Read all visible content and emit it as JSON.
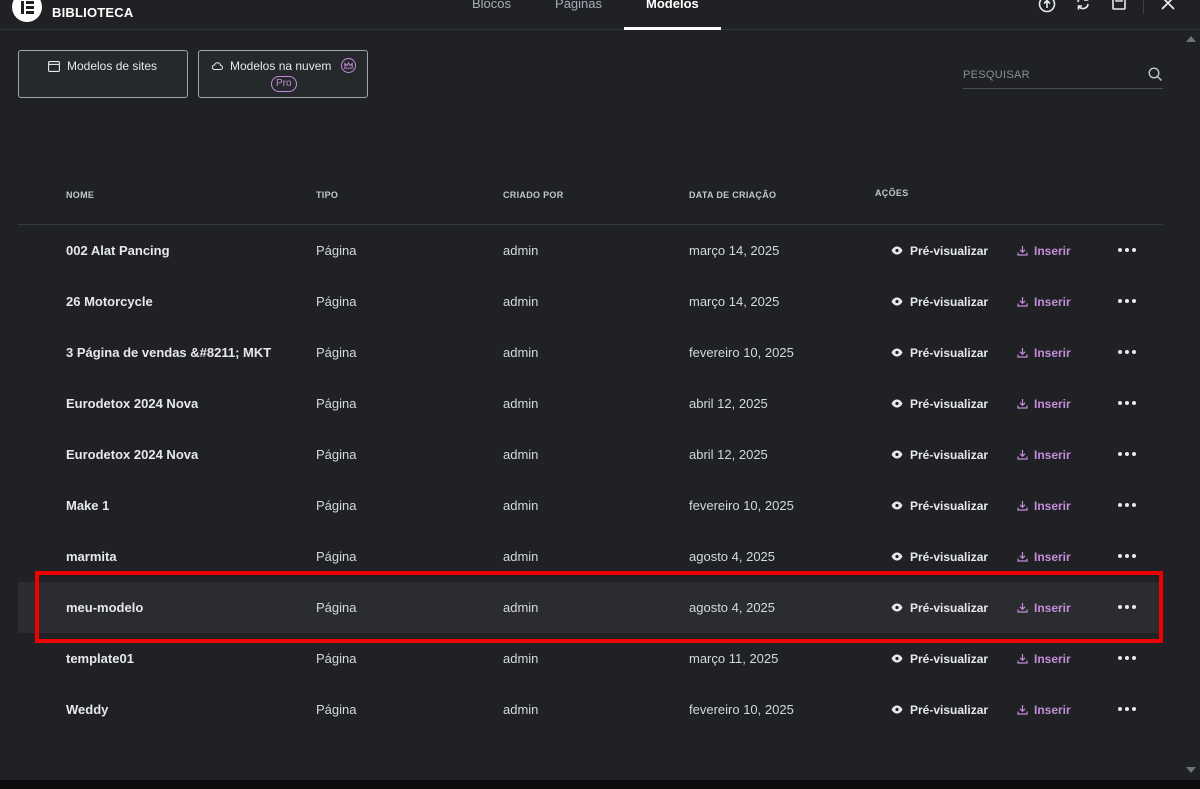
{
  "header": {
    "brand": "BIBLIOTECA",
    "tabs": [
      {
        "label": "Blocos",
        "active": false
      },
      {
        "label": "Páginas",
        "active": false
      },
      {
        "label": "Modelos",
        "active": true
      }
    ],
    "tools": [
      "upload-icon",
      "sync-icon",
      "save-icon",
      "close-icon"
    ]
  },
  "filters": {
    "site_templates": "Modelos de sites",
    "cloud_templates": "Modelos na nuvem",
    "pro_badge": "Pro"
  },
  "search": {
    "placeholder": "PESQUISAR"
  },
  "table": {
    "columns": {
      "name": "NOME",
      "type": "TIPO",
      "created_by": "CRIADO POR",
      "created_date": "DATA DE CRIAÇÃO",
      "actions": "AÇÕES"
    },
    "action_labels": {
      "preview": "Pré-visualizar",
      "insert": "Inserir"
    },
    "rows": [
      {
        "name": "002 Alat Pancing",
        "type": "Página",
        "author": "admin",
        "date": "março 14, 2025"
      },
      {
        "name": "26 Motorcycle",
        "type": "Página",
        "author": "admin",
        "date": "março 14, 2025"
      },
      {
        "name": "3 Página de vendas &#8211; MKT",
        "type": "Página",
        "author": "admin",
        "date": "fevereiro 10, 2025"
      },
      {
        "name": "Eurodetox 2024 Nova",
        "type": "Página",
        "author": "admin",
        "date": "abril 12, 2025"
      },
      {
        "name": "Eurodetox 2024 Nova",
        "type": "Página",
        "author": "admin",
        "date": "abril 12, 2025"
      },
      {
        "name": "Make 1",
        "type": "Página",
        "author": "admin",
        "date": "fevereiro 10, 2025"
      },
      {
        "name": "marmita",
        "type": "Página",
        "author": "admin",
        "date": "agosto 4, 2025"
      },
      {
        "name": "meu-modelo",
        "type": "Página",
        "author": "admin",
        "date": "agosto 4, 2025",
        "highlighted": true
      },
      {
        "name": "template01",
        "type": "Página",
        "author": "admin",
        "date": "março 11, 2025"
      },
      {
        "name": "Weddy",
        "type": "Página",
        "author": "admin",
        "date": "fevereiro 10, 2025"
      }
    ]
  },
  "colors": {
    "background": "#1f2124",
    "accent_pro": "#c38dd9",
    "highlight_border": "#ef0000",
    "text": "#d5d8dc"
  }
}
